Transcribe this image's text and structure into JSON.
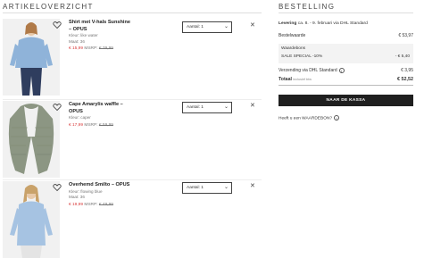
{
  "overview": {
    "title": "ARTIKELOVERZICHT",
    "items": [
      {
        "name": "Shirt met V-hals Sunshine – OPUS",
        "color": "Kleur: like water",
        "size": "Maat: 36",
        "price_now": "€ 15,99",
        "msrp_label": "MSRP:",
        "price_old": "€ 39,99",
        "qty_label": "Aantal: 1"
      },
      {
        "name": "Cape Amarylis waffle – OPUS",
        "color": "Kleur: caper",
        "size": "",
        "price_now": "€ 17,99",
        "msrp_label": "MSRP:",
        "price_old": "€ 59,99",
        "qty_label": "Aantal: 1"
      },
      {
        "name": "Overhemd Smilto – OPUS",
        "color": "Kleur: flowing blue",
        "size": "Maat: 36",
        "price_now": "€ 19,99",
        "msrp_label": "MSRP:",
        "price_old": "€ 49,99",
        "qty_label": "Aantal: 1"
      }
    ]
  },
  "order": {
    "title": "BESTELLING",
    "delivery_label": "Levering",
    "delivery_text": "ca. 8. - 9. februari via DHL Standard",
    "order_value_label": "Bestelwaarde",
    "order_value": "€ 53,97",
    "voucher_label": "Waardebons",
    "voucher_name": "SALE SPECIAL -10%",
    "voucher_value": "- € 5,40",
    "shipping_label": "Verzending via DHL Standard",
    "shipping_value": "€ 3,95",
    "total_label": "Totaal",
    "total_vat": "inclusief btw",
    "total_value": "€ 52,52",
    "checkout_label": "NAAR DE KASSA",
    "voucher_link": "Heeft u een WAARDEBON?"
  },
  "colors": {
    "sale_red": "#d93a3a",
    "button_dark": "#1f1f1f"
  }
}
